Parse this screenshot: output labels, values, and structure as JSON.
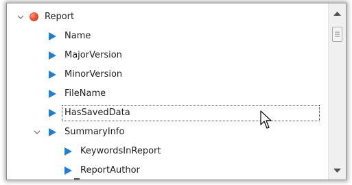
{
  "tree": {
    "root": {
      "label": "Report",
      "expanded": true
    },
    "items": [
      {
        "label": "Name",
        "selected": false
      },
      {
        "label": "MajorVersion",
        "selected": false
      },
      {
        "label": "MinorVersion",
        "selected": false
      },
      {
        "label": "FileName",
        "selected": false
      },
      {
        "label": "HasSavedData",
        "selected": true
      },
      {
        "label": "SummaryInfo",
        "expanded": true
      },
      {
        "label": "KeywordsInReport",
        "selected": false
      },
      {
        "label": "ReportAuthor",
        "selected": false
      }
    ]
  },
  "icons": {
    "expand": "chevron-down-icon",
    "property": "triangle-right-icon",
    "root": "red-dot-icon"
  },
  "colors": {
    "triangle": "#1f7fd6",
    "root_dot": "#f0502f",
    "scrollbar": "#f0f0f0"
  },
  "scrollbar": {
    "position_fraction": 0.0
  }
}
